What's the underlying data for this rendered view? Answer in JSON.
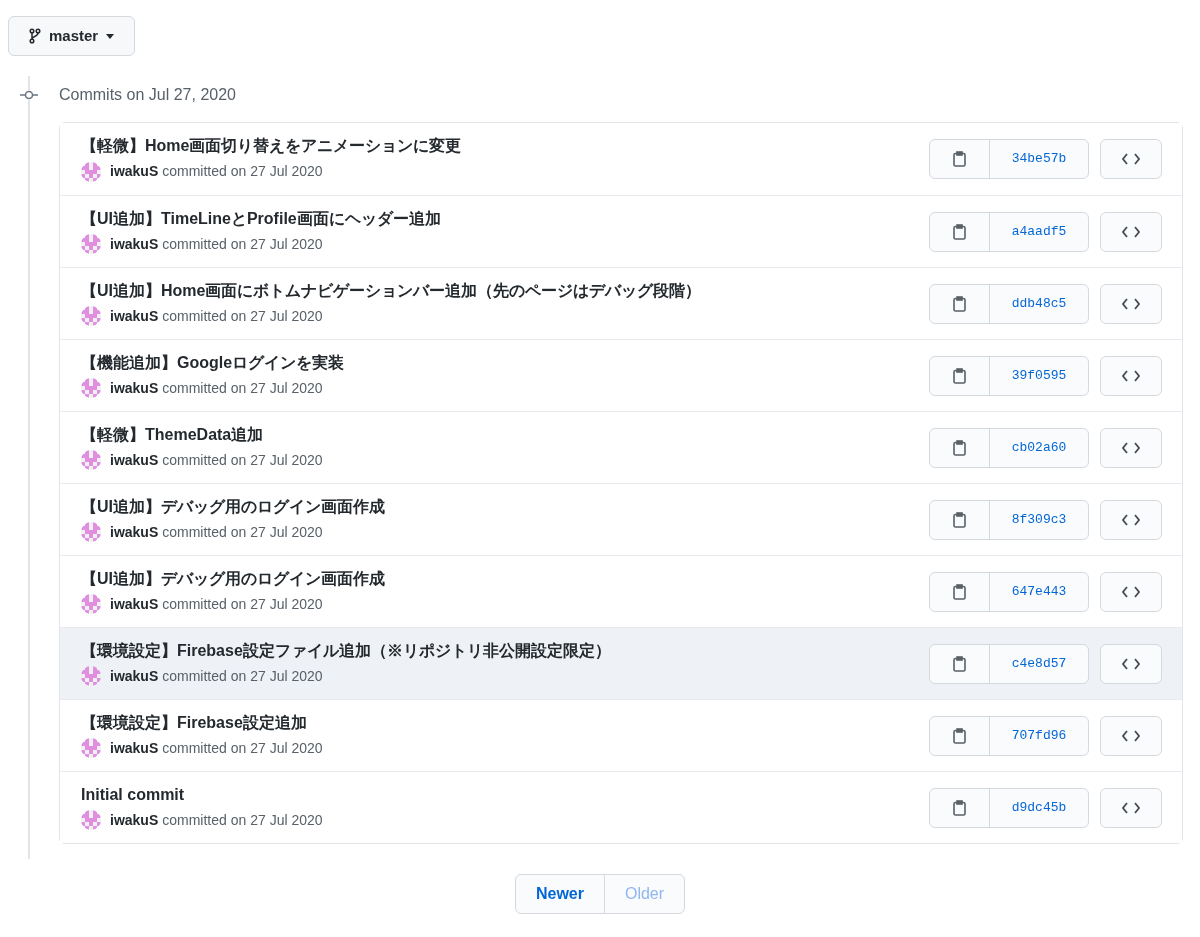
{
  "branch": {
    "label": "master"
  },
  "group": {
    "title": "Commits on Jul 27, 2020"
  },
  "commits": [
    {
      "message": "【軽微】Home画面切り替えをアニメーションに変更",
      "author": "iwakuS",
      "meta": "committed on 27 Jul 2020",
      "sha": "34be57b",
      "highlighted": false
    },
    {
      "message": "【UI追加】TimeLineとProfile画面にヘッダー追加",
      "author": "iwakuS",
      "meta": "committed on 27 Jul 2020",
      "sha": "a4aadf5",
      "highlighted": false
    },
    {
      "message": "【UI追加】Home画面にボトムナビゲーションバー追加（先のページはデバッグ段階）",
      "author": "iwakuS",
      "meta": "committed on 27 Jul 2020",
      "sha": "ddb48c5",
      "highlighted": false
    },
    {
      "message": "【機能追加】Googleログインを実装",
      "author": "iwakuS",
      "meta": "committed on 27 Jul 2020",
      "sha": "39f0595",
      "highlighted": false
    },
    {
      "message": "【軽微】ThemeData追加",
      "author": "iwakuS",
      "meta": "committed on 27 Jul 2020",
      "sha": "cb02a60",
      "highlighted": false
    },
    {
      "message": "【UI追加】デバッグ用のログイン画面作成",
      "author": "iwakuS",
      "meta": "committed on 27 Jul 2020",
      "sha": "8f309c3",
      "highlighted": false
    },
    {
      "message": "【UI追加】デバッグ用のログイン画面作成",
      "author": "iwakuS",
      "meta": "committed on 27 Jul 2020",
      "sha": "647e443",
      "highlighted": false
    },
    {
      "message": "【環境設定】Firebase設定ファイル追加（※リポジトリ非公開設定限定）",
      "author": "iwakuS",
      "meta": "committed on 27 Jul 2020",
      "sha": "c4e8d57",
      "highlighted": true
    },
    {
      "message": "【環境設定】Firebase設定追加",
      "author": "iwakuS",
      "meta": "committed on 27 Jul 2020",
      "sha": "707fd96",
      "highlighted": false
    },
    {
      "message": "Initial commit",
      "author": "iwakuS",
      "meta": "committed on 27 Jul 2020",
      "sha": "d9dc45b",
      "highlighted": false
    }
  ],
  "pagination": [
    {
      "label": "Newer",
      "disabled": false
    },
    {
      "label": "Older",
      "disabled": true
    }
  ]
}
